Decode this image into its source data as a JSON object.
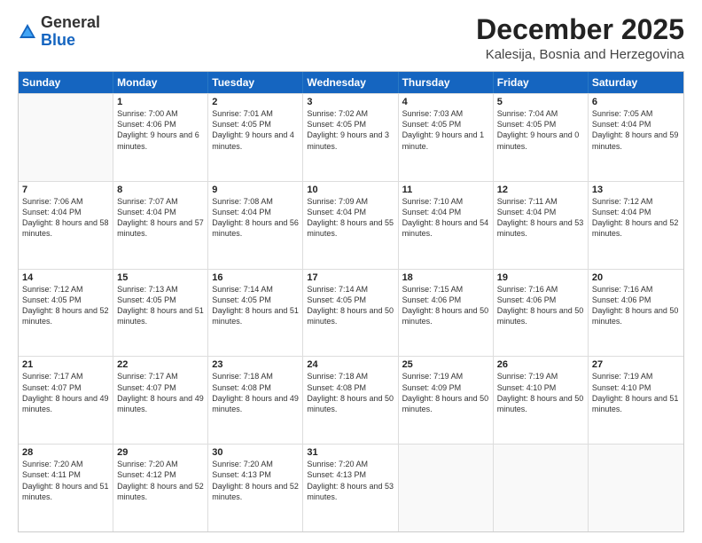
{
  "logo": {
    "general": "General",
    "blue": "Blue"
  },
  "header": {
    "month": "December 2025",
    "location": "Kalesija, Bosnia and Herzegovina"
  },
  "weekdays": [
    "Sunday",
    "Monday",
    "Tuesday",
    "Wednesday",
    "Thursday",
    "Friday",
    "Saturday"
  ],
  "rows": [
    [
      {
        "day": "",
        "sunrise": "",
        "sunset": "",
        "daylight": "",
        "empty": true
      },
      {
        "day": "1",
        "sunrise": "Sunrise: 7:00 AM",
        "sunset": "Sunset: 4:06 PM",
        "daylight": "Daylight: 9 hours and 6 minutes."
      },
      {
        "day": "2",
        "sunrise": "Sunrise: 7:01 AM",
        "sunset": "Sunset: 4:05 PM",
        "daylight": "Daylight: 9 hours and 4 minutes."
      },
      {
        "day": "3",
        "sunrise": "Sunrise: 7:02 AM",
        "sunset": "Sunset: 4:05 PM",
        "daylight": "Daylight: 9 hours and 3 minutes."
      },
      {
        "day": "4",
        "sunrise": "Sunrise: 7:03 AM",
        "sunset": "Sunset: 4:05 PM",
        "daylight": "Daylight: 9 hours and 1 minute."
      },
      {
        "day": "5",
        "sunrise": "Sunrise: 7:04 AM",
        "sunset": "Sunset: 4:05 PM",
        "daylight": "Daylight: 9 hours and 0 minutes."
      },
      {
        "day": "6",
        "sunrise": "Sunrise: 7:05 AM",
        "sunset": "Sunset: 4:04 PM",
        "daylight": "Daylight: 8 hours and 59 minutes."
      }
    ],
    [
      {
        "day": "7",
        "sunrise": "Sunrise: 7:06 AM",
        "sunset": "Sunset: 4:04 PM",
        "daylight": "Daylight: 8 hours and 58 minutes."
      },
      {
        "day": "8",
        "sunrise": "Sunrise: 7:07 AM",
        "sunset": "Sunset: 4:04 PM",
        "daylight": "Daylight: 8 hours and 57 minutes."
      },
      {
        "day": "9",
        "sunrise": "Sunrise: 7:08 AM",
        "sunset": "Sunset: 4:04 PM",
        "daylight": "Daylight: 8 hours and 56 minutes."
      },
      {
        "day": "10",
        "sunrise": "Sunrise: 7:09 AM",
        "sunset": "Sunset: 4:04 PM",
        "daylight": "Daylight: 8 hours and 55 minutes."
      },
      {
        "day": "11",
        "sunrise": "Sunrise: 7:10 AM",
        "sunset": "Sunset: 4:04 PM",
        "daylight": "Daylight: 8 hours and 54 minutes."
      },
      {
        "day": "12",
        "sunrise": "Sunrise: 7:11 AM",
        "sunset": "Sunset: 4:04 PM",
        "daylight": "Daylight: 8 hours and 53 minutes."
      },
      {
        "day": "13",
        "sunrise": "Sunrise: 7:12 AM",
        "sunset": "Sunset: 4:04 PM",
        "daylight": "Daylight: 8 hours and 52 minutes."
      }
    ],
    [
      {
        "day": "14",
        "sunrise": "Sunrise: 7:12 AM",
        "sunset": "Sunset: 4:05 PM",
        "daylight": "Daylight: 8 hours and 52 minutes."
      },
      {
        "day": "15",
        "sunrise": "Sunrise: 7:13 AM",
        "sunset": "Sunset: 4:05 PM",
        "daylight": "Daylight: 8 hours and 51 minutes."
      },
      {
        "day": "16",
        "sunrise": "Sunrise: 7:14 AM",
        "sunset": "Sunset: 4:05 PM",
        "daylight": "Daylight: 8 hours and 51 minutes."
      },
      {
        "day": "17",
        "sunrise": "Sunrise: 7:14 AM",
        "sunset": "Sunset: 4:05 PM",
        "daylight": "Daylight: 8 hours and 50 minutes."
      },
      {
        "day": "18",
        "sunrise": "Sunrise: 7:15 AM",
        "sunset": "Sunset: 4:06 PM",
        "daylight": "Daylight: 8 hours and 50 minutes."
      },
      {
        "day": "19",
        "sunrise": "Sunrise: 7:16 AM",
        "sunset": "Sunset: 4:06 PM",
        "daylight": "Daylight: 8 hours and 50 minutes."
      },
      {
        "day": "20",
        "sunrise": "Sunrise: 7:16 AM",
        "sunset": "Sunset: 4:06 PM",
        "daylight": "Daylight: 8 hours and 50 minutes."
      }
    ],
    [
      {
        "day": "21",
        "sunrise": "Sunrise: 7:17 AM",
        "sunset": "Sunset: 4:07 PM",
        "daylight": "Daylight: 8 hours and 49 minutes."
      },
      {
        "day": "22",
        "sunrise": "Sunrise: 7:17 AM",
        "sunset": "Sunset: 4:07 PM",
        "daylight": "Daylight: 8 hours and 49 minutes."
      },
      {
        "day": "23",
        "sunrise": "Sunrise: 7:18 AM",
        "sunset": "Sunset: 4:08 PM",
        "daylight": "Daylight: 8 hours and 49 minutes."
      },
      {
        "day": "24",
        "sunrise": "Sunrise: 7:18 AM",
        "sunset": "Sunset: 4:08 PM",
        "daylight": "Daylight: 8 hours and 50 minutes."
      },
      {
        "day": "25",
        "sunrise": "Sunrise: 7:19 AM",
        "sunset": "Sunset: 4:09 PM",
        "daylight": "Daylight: 8 hours and 50 minutes."
      },
      {
        "day": "26",
        "sunrise": "Sunrise: 7:19 AM",
        "sunset": "Sunset: 4:10 PM",
        "daylight": "Daylight: 8 hours and 50 minutes."
      },
      {
        "day": "27",
        "sunrise": "Sunrise: 7:19 AM",
        "sunset": "Sunset: 4:10 PM",
        "daylight": "Daylight: 8 hours and 51 minutes."
      }
    ],
    [
      {
        "day": "28",
        "sunrise": "Sunrise: 7:20 AM",
        "sunset": "Sunset: 4:11 PM",
        "daylight": "Daylight: 8 hours and 51 minutes."
      },
      {
        "day": "29",
        "sunrise": "Sunrise: 7:20 AM",
        "sunset": "Sunset: 4:12 PM",
        "daylight": "Daylight: 8 hours and 52 minutes."
      },
      {
        "day": "30",
        "sunrise": "Sunrise: 7:20 AM",
        "sunset": "Sunset: 4:13 PM",
        "daylight": "Daylight: 8 hours and 52 minutes."
      },
      {
        "day": "31",
        "sunrise": "Sunrise: 7:20 AM",
        "sunset": "Sunset: 4:13 PM",
        "daylight": "Daylight: 8 hours and 53 minutes."
      },
      {
        "day": "",
        "sunrise": "",
        "sunset": "",
        "daylight": "",
        "empty": true
      },
      {
        "day": "",
        "sunrise": "",
        "sunset": "",
        "daylight": "",
        "empty": true
      },
      {
        "day": "",
        "sunrise": "",
        "sunset": "",
        "daylight": "",
        "empty": true
      }
    ]
  ]
}
